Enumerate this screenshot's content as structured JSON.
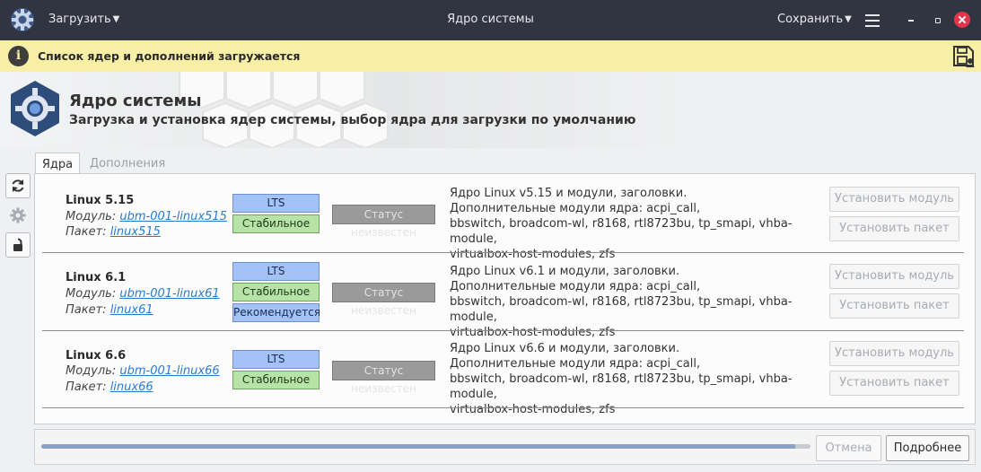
{
  "titlebar": {
    "load_menu": "Загрузить",
    "title": "Ядро системы",
    "save_menu": "Сохранить"
  },
  "notice": {
    "text": "Список ядер и дополнений загружается"
  },
  "header": {
    "title": "Ядро системы",
    "subtitle": "Загрузка и установка ядер системы, выбор ядра для загрузки по умолчанию"
  },
  "tabs": [
    {
      "label": "Ядра",
      "active": true
    },
    {
      "label": "Дополнения",
      "active": false
    }
  ],
  "kernels": [
    {
      "name": "Linux 5.15",
      "module_label": "Модуль:",
      "module": "ubm-001-linux515",
      "package_label": "Пакет:",
      "package": "linux515",
      "badges": [
        "LTS",
        "Стабильное"
      ],
      "status": "Статус неизвестен",
      "desc": [
        "Ядро Linux v5.15 и модули, заголовки.",
        "Дополнительные модули ядра: acpi_call,",
        "bbswitch, broadcom-wl, r8168, rtl8723bu, tp_smapi, vhba-module,",
        "virtualbox-host-modules, zfs"
      ],
      "install_module": "Установить модуль",
      "install_package": "Установить пакет"
    },
    {
      "name": "Linux 6.1",
      "module_label": "Модуль:",
      "module": "ubm-001-linux61",
      "package_label": "Пакет:",
      "package": "linux61",
      "badges": [
        "LTS",
        "Стабильное",
        "Рекомендуется"
      ],
      "status": "Статус неизвестен",
      "desc": [
        "Ядро Linux v6.1 и модули, заголовки.",
        "Дополнительные модули ядра: acpi_call,",
        "bbswitch, broadcom-wl, r8168, rtl8723bu, tp_smapi, vhba-module,",
        "virtualbox-host-modules, zfs"
      ],
      "install_module": "Установить модуль",
      "install_package": "Установить пакет"
    },
    {
      "name": "Linux 6.6",
      "module_label": "Модуль:",
      "module": "ubm-001-linux66",
      "package_label": "Пакет:",
      "package": "linux66",
      "badges": [
        "LTS",
        "Стабильное"
      ],
      "status": "Статус неизвестен",
      "desc": [
        "Ядро Linux v6.6 и модули, заголовки.",
        "Дополнительные модули ядра: acpi_call,",
        "bbswitch, broadcom-wl, r8168, rtl8723bu, tp_smapi, vhba-module,",
        "virtualbox-host-modules, zfs"
      ],
      "install_module": "Установить модуль",
      "install_package": "Установить пакет"
    }
  ],
  "footer": {
    "cancel": "Отмена",
    "more": "Подробнее",
    "progress": 0.98
  },
  "icons": {
    "app": "gear-icon",
    "refresh": "refresh-icon",
    "settings": "gear-icon",
    "lock": "lock-icon",
    "info": "info-icon",
    "save_user": "save-user-icon"
  },
  "colors": {
    "titlebar": "#303541",
    "notice": "#f7efa6",
    "lts_badge": "#a3c2f5",
    "stable_badge": "#b7e2a8",
    "status_badge": "#9a9a9a",
    "link": "#2a7bd1"
  }
}
